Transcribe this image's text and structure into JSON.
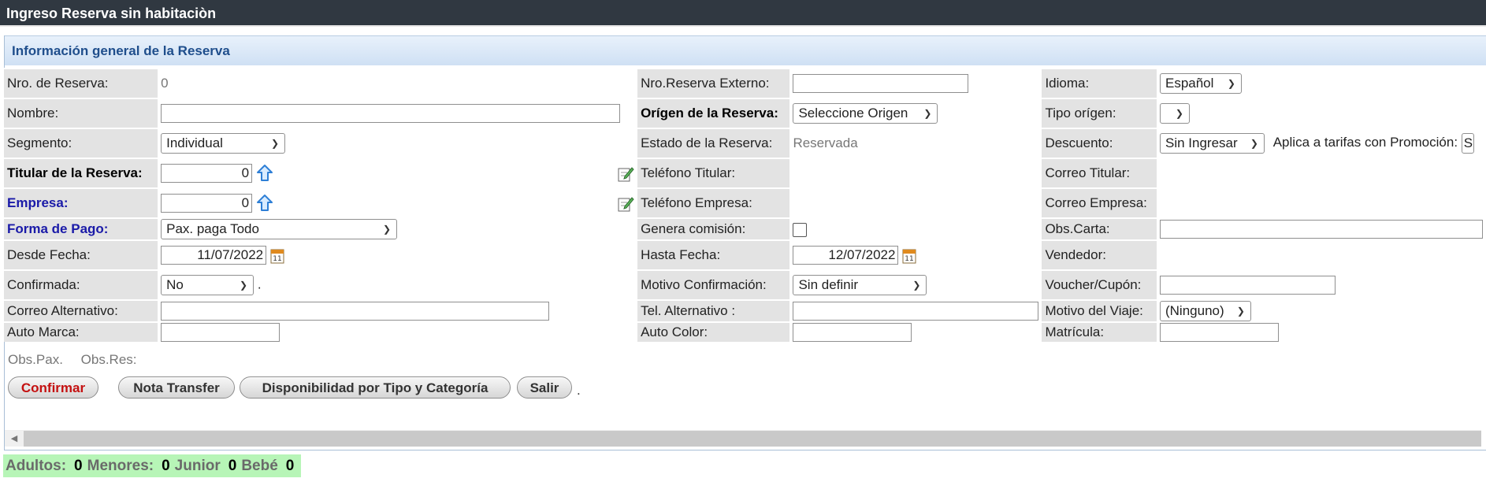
{
  "window": {
    "title": "Ingreso Reserva sin habitaciòn"
  },
  "section": {
    "title": "Información general de la Reserva"
  },
  "fields": {
    "nro_reserva": {
      "label": "Nro. de Reserva:",
      "value": "0"
    },
    "nro_reserva_externo": {
      "label": "Nro.Reserva Externo:",
      "value": ""
    },
    "idioma": {
      "label": "Idioma:",
      "value": "Español"
    },
    "nombre": {
      "label": "Nombre:",
      "value": ""
    },
    "origen": {
      "label": "Orígen de la Reserva:",
      "value": "Seleccione Origen"
    },
    "tipo_origen": {
      "label": "Tipo orígen:",
      "value": ""
    },
    "segmento": {
      "label": "Segmento:",
      "value": "Individual"
    },
    "estado": {
      "label": "Estado de la Reserva:",
      "value": "Reservada"
    },
    "descuento": {
      "label": "Descuento:",
      "value": "Sin Ingresar",
      "promo_label": "Aplica a tarifas con Promoción:",
      "promo_value": "S"
    },
    "titular": {
      "label": "Titular de la Reserva:",
      "value": "0"
    },
    "telefono_titular": {
      "label": "Teléfono Titular:",
      "value": ""
    },
    "correo_titular": {
      "label": "Correo Titular:",
      "value": ""
    },
    "empresa": {
      "label": "Empresa:",
      "value": "0"
    },
    "telefono_empresa": {
      "label": "Teléfono Empresa:",
      "value": ""
    },
    "correo_empresa": {
      "label": "Correo Empresa:",
      "value": ""
    },
    "forma_pago": {
      "label": "Forma de Pago:",
      "value": "Pax. paga Todo"
    },
    "genera_comision": {
      "label": "Genera comisión:",
      "checked": false
    },
    "obs_carta": {
      "label": "Obs.Carta:",
      "value": ""
    },
    "desde_fecha": {
      "label": "Desde Fecha:",
      "value": "11/07/2022"
    },
    "hasta_fecha": {
      "label": "Hasta Fecha:",
      "value": "12/07/2022"
    },
    "vendedor": {
      "label": "Vendedor:",
      "value": ""
    },
    "confirmada": {
      "label": "Confirmada:",
      "value": "No",
      "suffix": "."
    },
    "motivo_confirmacion": {
      "label": "Motivo Confirmación:",
      "value": "Sin definir"
    },
    "voucher": {
      "label": "Voucher/Cupón:",
      "value": ""
    },
    "correo_alternativo": {
      "label": "Correo Alternativo:",
      "value": ""
    },
    "tel_alternativo": {
      "label": "Tel. Alternativo :",
      "value": ""
    },
    "motivo_viaje": {
      "label": "Motivo del Viaje:",
      "value": "(Ninguno)"
    },
    "auto_marca": {
      "label": "Auto Marca:",
      "value": ""
    },
    "auto_color": {
      "label": "Auto Color:",
      "value": ""
    },
    "matricula": {
      "label": "Matrícula:",
      "value": ""
    }
  },
  "obs": {
    "pax": "Obs.Pax.",
    "res": "Obs.Res:"
  },
  "buttons": {
    "confirmar": "Confirmar",
    "nota_transfer": "Nota Transfer",
    "disponibilidad": "Disponibilidad por Tipo y Categoría",
    "salir": "Salir",
    "trailing_dot": "."
  },
  "counts": {
    "adultos_label": "Adultos:",
    "adultos": "0",
    "menores_label": "Menores:",
    "menores": "0",
    "junior_label": "Junior",
    "junior": "0",
    "bebe_label": "Bebé",
    "bebe": "0"
  },
  "colors": {
    "titlebar": "#303841",
    "header_text": "#1f4e8c",
    "label_bg": "#e3e3e3",
    "link_label": "#1a1aa8",
    "confirm_text": "#c41010",
    "counts_bg": "#b7f5b7"
  },
  "icons": {
    "titular_search": "arrow-up-icon",
    "empresa_search": "arrow-up-icon",
    "edit": "edit-note-icon",
    "calendar": "calendar-icon"
  }
}
